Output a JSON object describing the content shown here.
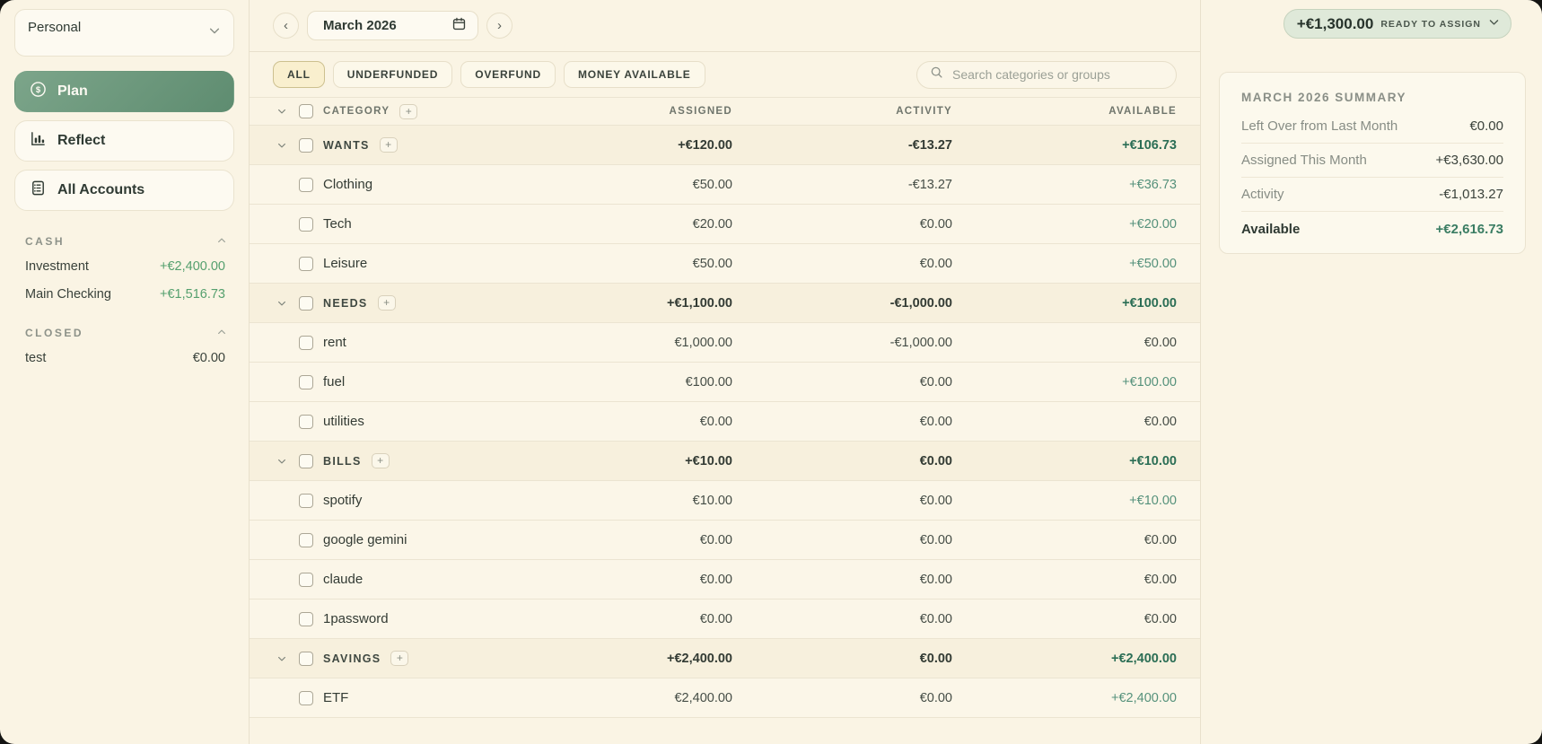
{
  "sidebar": {
    "budget_name": "Personal",
    "nav": [
      {
        "label": "Plan",
        "icon": "dollar-circle-icon",
        "active": true
      },
      {
        "label": "Reflect",
        "icon": "bar-chart-icon",
        "active": false
      },
      {
        "label": "All Accounts",
        "icon": "ledger-icon",
        "active": false
      }
    ],
    "sections": [
      {
        "title": "CASH",
        "accounts": [
          {
            "name": "Investment",
            "balance": "+€2,400.00"
          },
          {
            "name": "Main Checking",
            "balance": "+€1,516.73"
          }
        ]
      },
      {
        "title": "CLOSED",
        "accounts": [
          {
            "name": "test",
            "balance": "€0.00"
          }
        ]
      }
    ]
  },
  "topbar": {
    "month": "March 2026",
    "prev_glyph": "‹",
    "next_glyph": "›",
    "ready_amount": "+€1,300.00",
    "ready_label": "READY TO ASSIGN"
  },
  "filters": {
    "chips": [
      {
        "label": "ALL",
        "active": true
      },
      {
        "label": "UNDERFUNDED",
        "active": false
      },
      {
        "label": "OVERFUND",
        "active": false
      },
      {
        "label": "MONEY AVAILABLE",
        "active": false
      }
    ],
    "search_placeholder": "Search categories or groups"
  },
  "table": {
    "columns": {
      "category": "CATEGORY",
      "assigned": "ASSIGNED",
      "activity": "ACTIVITY",
      "available": "AVAILABLE"
    },
    "add_glyph": "+",
    "groups": [
      {
        "name": "WANTS",
        "assigned": "+€120.00",
        "activity": "-€13.27",
        "available": "+€106.73",
        "categories": [
          {
            "name": "Clothing",
            "assigned": "€50.00",
            "activity": "-€13.27",
            "available": "+€36.73"
          },
          {
            "name": "Tech",
            "assigned": "€20.00",
            "activity": "€0.00",
            "available": "+€20.00"
          },
          {
            "name": "Leisure",
            "assigned": "€50.00",
            "activity": "€0.00",
            "available": "+€50.00"
          }
        ]
      },
      {
        "name": "NEEDS",
        "assigned": "+€1,100.00",
        "activity": "-€1,000.00",
        "available": "+€100.00",
        "categories": [
          {
            "name": "rent",
            "assigned": "€1,000.00",
            "activity": "-€1,000.00",
            "available": "€0.00"
          },
          {
            "name": "fuel",
            "assigned": "€100.00",
            "activity": "€0.00",
            "available": "+€100.00"
          },
          {
            "name": "utilities",
            "assigned": "€0.00",
            "activity": "€0.00",
            "available": "€0.00"
          }
        ]
      },
      {
        "name": "BILLS",
        "assigned": "+€10.00",
        "activity": "€0.00",
        "available": "+€10.00",
        "categories": [
          {
            "name": "spotify",
            "assigned": "€10.00",
            "activity": "€0.00",
            "available": "+€10.00"
          },
          {
            "name": "google gemini",
            "assigned": "€0.00",
            "activity": "€0.00",
            "available": "€0.00"
          },
          {
            "name": "claude",
            "assigned": "€0.00",
            "activity": "€0.00",
            "available": "€0.00"
          },
          {
            "name": "1password",
            "assigned": "€0.00",
            "activity": "€0.00",
            "available": "€0.00"
          }
        ]
      },
      {
        "name": "SAVINGS",
        "assigned": "+€2,400.00",
        "activity": "€0.00",
        "available": "+€2,400.00",
        "categories": [
          {
            "name": "ETF",
            "assigned": "€2,400.00",
            "activity": "€0.00",
            "available": "+€2,400.00"
          }
        ]
      }
    ]
  },
  "summary": {
    "title": "MARCH 2026 SUMMARY",
    "rows": [
      {
        "label": "Left Over from Last Month",
        "value": "€0.00",
        "emphasis": false
      },
      {
        "label": "Assigned This Month",
        "value": "+€3,630.00",
        "emphasis": false
      },
      {
        "label": "Activity",
        "value": "-€1,013.27",
        "emphasis": false
      },
      {
        "label": "Available",
        "value": "+€2,616.73",
        "emphasis": true
      }
    ]
  },
  "colors": {
    "background": "#FAF4E4",
    "accent_green": "#5E8C70",
    "positive_green": "#55917B",
    "group_positive_green": "#2B6E55",
    "sidebar_positive_green": "#55A06E",
    "ready_pill_bg": "#DFE9D9",
    "active_chip_bg": "#F9EFCE",
    "group_row_bg": "#F7F0DD",
    "category_row_bg": "#FBF6E8"
  }
}
